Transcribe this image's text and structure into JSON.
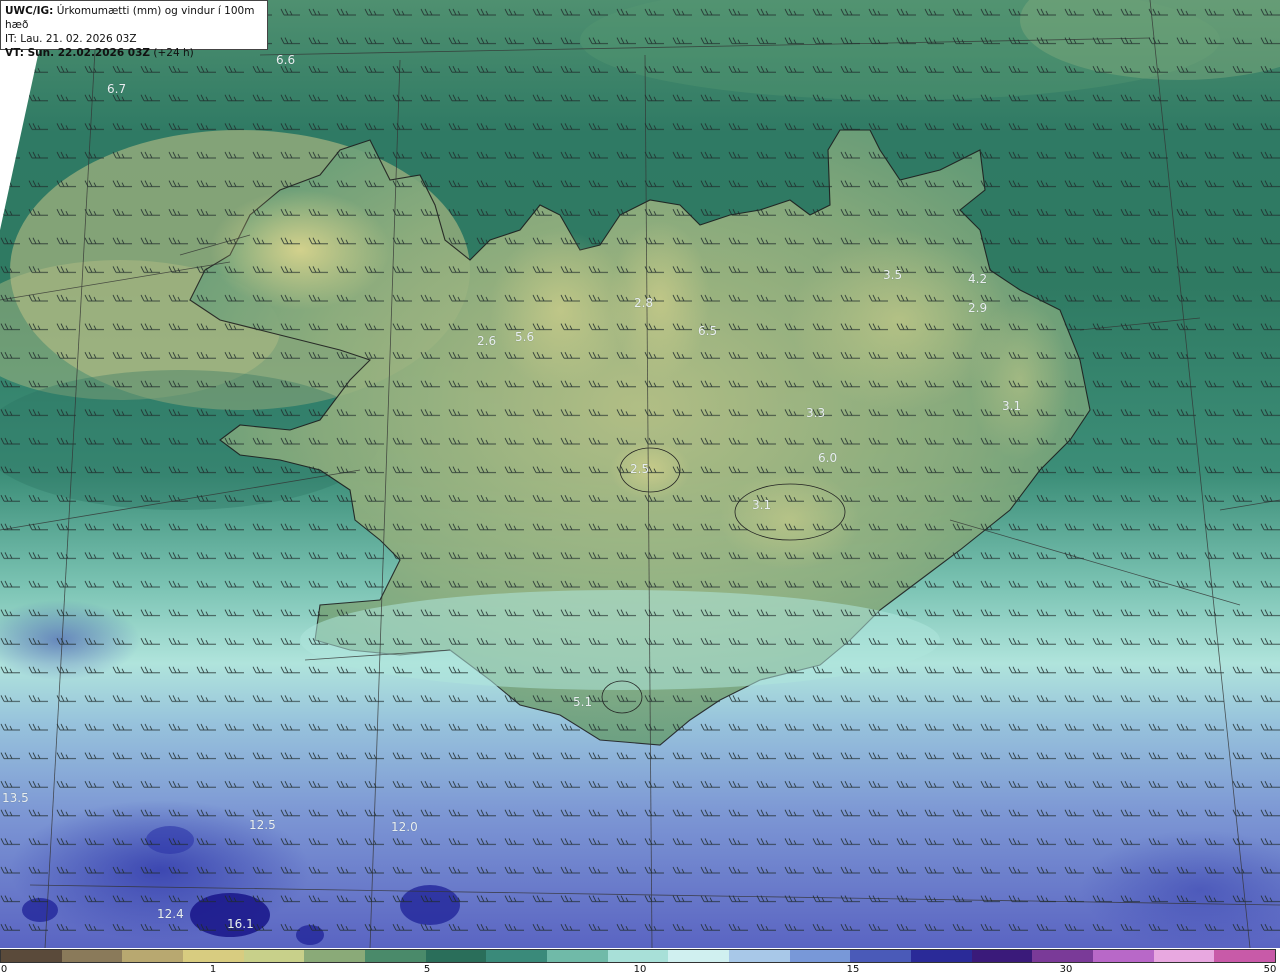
{
  "header": {
    "line1_bold": "UWC/IG:",
    "line1_text": " Úrkomumætti (mm) og vindur í 100m hæð",
    "line2": "IT: Lau. 21. 02. 2026 03Z",
    "line3_bold": "VT: Sun. 22.02.2026 03Z",
    "line3_text": " (+24 h)"
  },
  "map": {
    "value_labels": [
      {
        "text": "6.6",
        "value": 6.6
      },
      {
        "text": "6.7",
        "value": 6.7
      },
      {
        "text": "3.5",
        "value": 3.5
      },
      {
        "text": "4.2",
        "value": 4.2
      },
      {
        "text": "2.9",
        "value": 2.9
      },
      {
        "text": "2.8",
        "value": 2.8
      },
      {
        "text": "6.5",
        "value": 6.5
      },
      {
        "text": "2.6",
        "value": 2.6
      },
      {
        "text": "5.6",
        "value": 5.6
      },
      {
        "text": "3.3",
        "value": 3.3
      },
      {
        "text": "3.1",
        "value": 3.1
      },
      {
        "text": "6.0",
        "value": 6.0
      },
      {
        "text": "2.5",
        "value": 2.5
      },
      {
        "text": "3.1",
        "value": 3.1
      },
      {
        "text": "5.1",
        "value": 5.1
      },
      {
        "text": "13.5",
        "value": 13.5
      },
      {
        "text": "12.5",
        "value": 12.5
      },
      {
        "text": "12.0",
        "value": 12.0
      },
      {
        "text": "12.4",
        "value": 12.4
      },
      {
        "text": "16.1",
        "value": 16.1
      }
    ]
  },
  "colorbar": {
    "ticks": [
      "0",
      "1",
      "5",
      "10",
      "15",
      "30",
      "50"
    ],
    "colors": [
      "#5a4a3a",
      "#8a7a5a",
      "#b8a870",
      "#d8cc80",
      "#c8d08a",
      "#8aaa78",
      "#4a8a6a",
      "#2a6e5a",
      "#3a8a7a",
      "#70baa8",
      "#a8e0d8",
      "#d0f0f0",
      "#a8c8e8",
      "#7898d8",
      "#4a5ab8",
      "#2a2a98",
      "#3a1a7a",
      "#7a3a98",
      "#b868c8",
      "#e8a8e0",
      "#c85aa8"
    ]
  },
  "palette": {
    "sea_green": "#2f7a64",
    "land_yellow": "#c9c98a",
    "cyan": "#a6ddd6",
    "blue": "#4e5cc0",
    "coast": "#222222"
  }
}
